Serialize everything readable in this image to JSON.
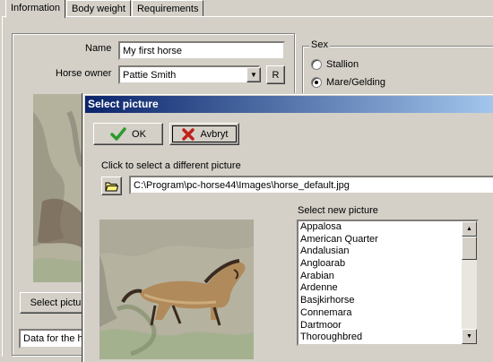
{
  "tabs": [
    {
      "label": "Information",
      "active": true
    },
    {
      "label": "Body weight",
      "active": false
    },
    {
      "label": "Requirements",
      "active": false
    }
  ],
  "form": {
    "name_label": "Name",
    "name_value": "My first horse",
    "owner_label": "Horse owner",
    "owner_value": "Pattie Smith",
    "owner_button": "R",
    "select_picture_button": "Select pictu",
    "notes_text": "Data for the h"
  },
  "sex": {
    "title": "Sex",
    "options": [
      {
        "label": "Stallion",
        "selected": false
      },
      {
        "label": "Mare/Gelding",
        "selected": true
      }
    ]
  },
  "dialog": {
    "title": "Select picture",
    "ok_label": "OK",
    "cancel_label": "Avbryt",
    "click_label": "Click to select a different picture",
    "path_value": "C:\\Program\\pc-horse44\\Images\\horse_default.jpg",
    "list_label": "Select new picture",
    "breeds": [
      "Appalosa",
      "American Quarter",
      "Andalusian",
      "Angloarab",
      "Arabian",
      "Ardenne",
      "Basjkirhorse",
      "Connemara",
      "Dartmoor",
      "Thoroughbred"
    ],
    "icons": {
      "ok": "checkmark-icon",
      "cancel": "x-icon",
      "folder": "folder-icon"
    },
    "colors": {
      "title_start": "#0a246a",
      "title_end": "#a6caf0",
      "ok_check": "#2d9a2d",
      "cancel_x": "#c0201a"
    }
  }
}
